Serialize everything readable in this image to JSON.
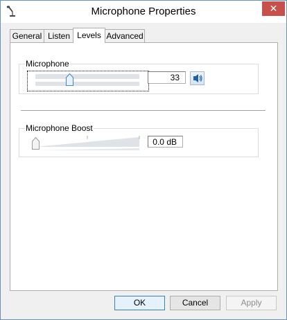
{
  "window": {
    "title": "Microphone Properties"
  },
  "tabs": [
    {
      "label": "General"
    },
    {
      "label": "Listen"
    },
    {
      "label": "Levels",
      "active": true
    },
    {
      "label": "Advanced"
    }
  ],
  "microphone": {
    "label": "Microphone",
    "value": "33",
    "level_percent": 33
  },
  "boost": {
    "label": "Microphone Boost",
    "value": "0.0 dB",
    "level_percent": 0
  },
  "buttons": {
    "ok": "OK",
    "cancel": "Cancel",
    "apply": "Apply"
  },
  "icons": {
    "app": "microphone-icon",
    "close": "close-icon",
    "speaker": "speaker-icon"
  },
  "colors": {
    "close_button": "#c7504a",
    "slider_thumb": "#3b87d0",
    "border": "#6b8fb6"
  }
}
